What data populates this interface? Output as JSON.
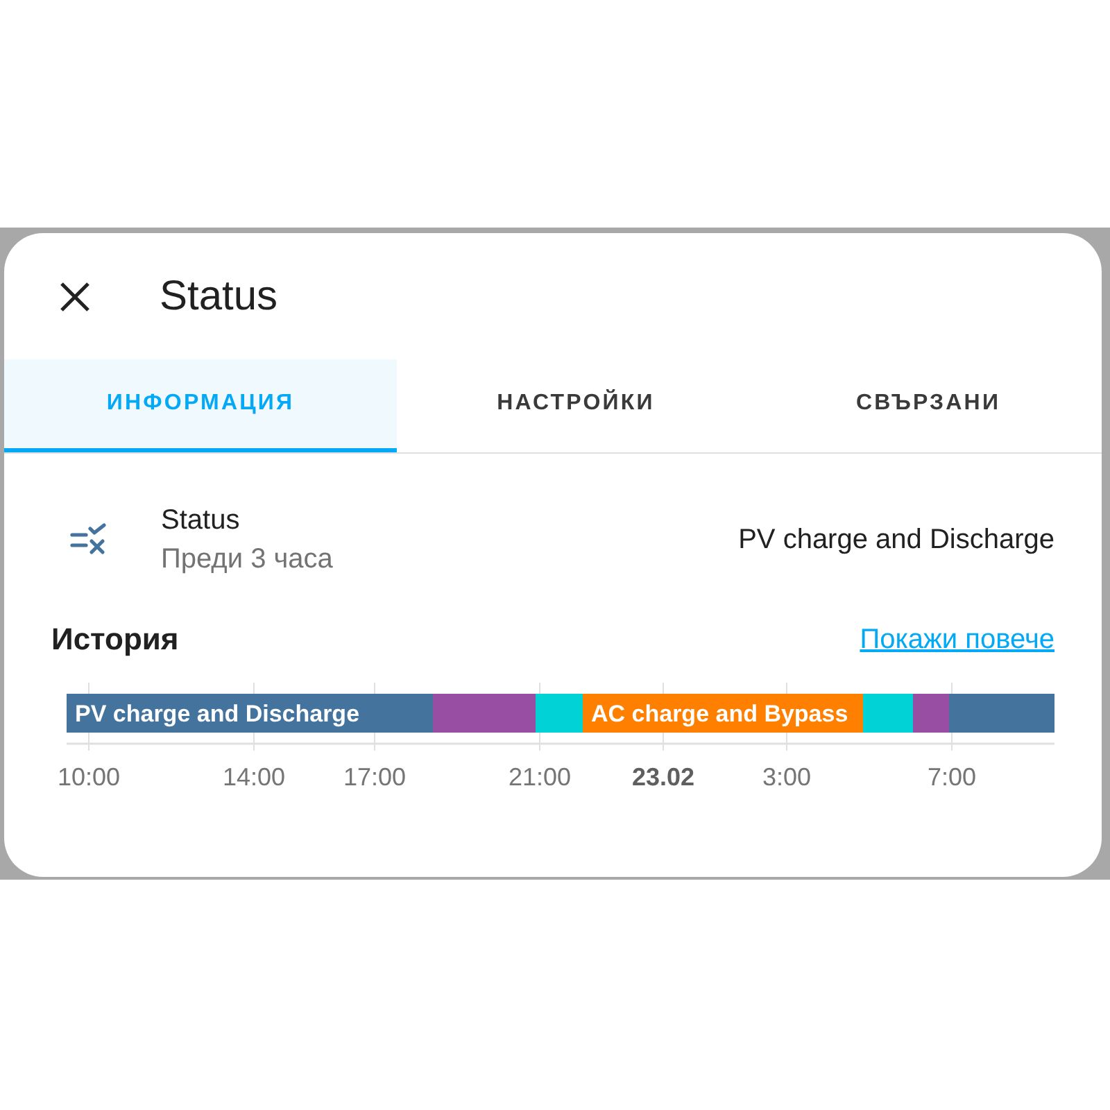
{
  "dialog": {
    "title": "Status"
  },
  "tabs": [
    {
      "label": "ИНФОРМАЦИЯ",
      "selected": true
    },
    {
      "label": "НАСТРОЙКИ",
      "selected": false
    },
    {
      "label": "СВЪРЗАНИ",
      "selected": false
    }
  ],
  "entity": {
    "name": "Status",
    "last_changed": "Преди 3 часа",
    "state": "PV charge and Discharge"
  },
  "history": {
    "heading": "История",
    "link": "Покажи повече",
    "timeline": {
      "segments": [
        {
          "label": "PV charge and Discharge",
          "color": "#44739e"
        },
        {
          "color": "#984ea3"
        },
        {
          "color": "#00d2d5"
        },
        {
          "label": "AC charge and Bypass",
          "color": "#ff7f00"
        },
        {
          "color": "#00d2d5"
        },
        {
          "color": "#984ea3"
        },
        {
          "color": "#44739e"
        }
      ],
      "ticks": [
        {
          "label": "10:00",
          "kind": "time"
        },
        {
          "label": "14:00",
          "kind": "time"
        },
        {
          "label": "17:00",
          "kind": "time"
        },
        {
          "label": "21:00",
          "kind": "time"
        },
        {
          "label": "23.02",
          "kind": "date"
        },
        {
          "label": "3:00",
          "kind": "time"
        },
        {
          "label": "7:00",
          "kind": "time"
        }
      ]
    }
  }
}
